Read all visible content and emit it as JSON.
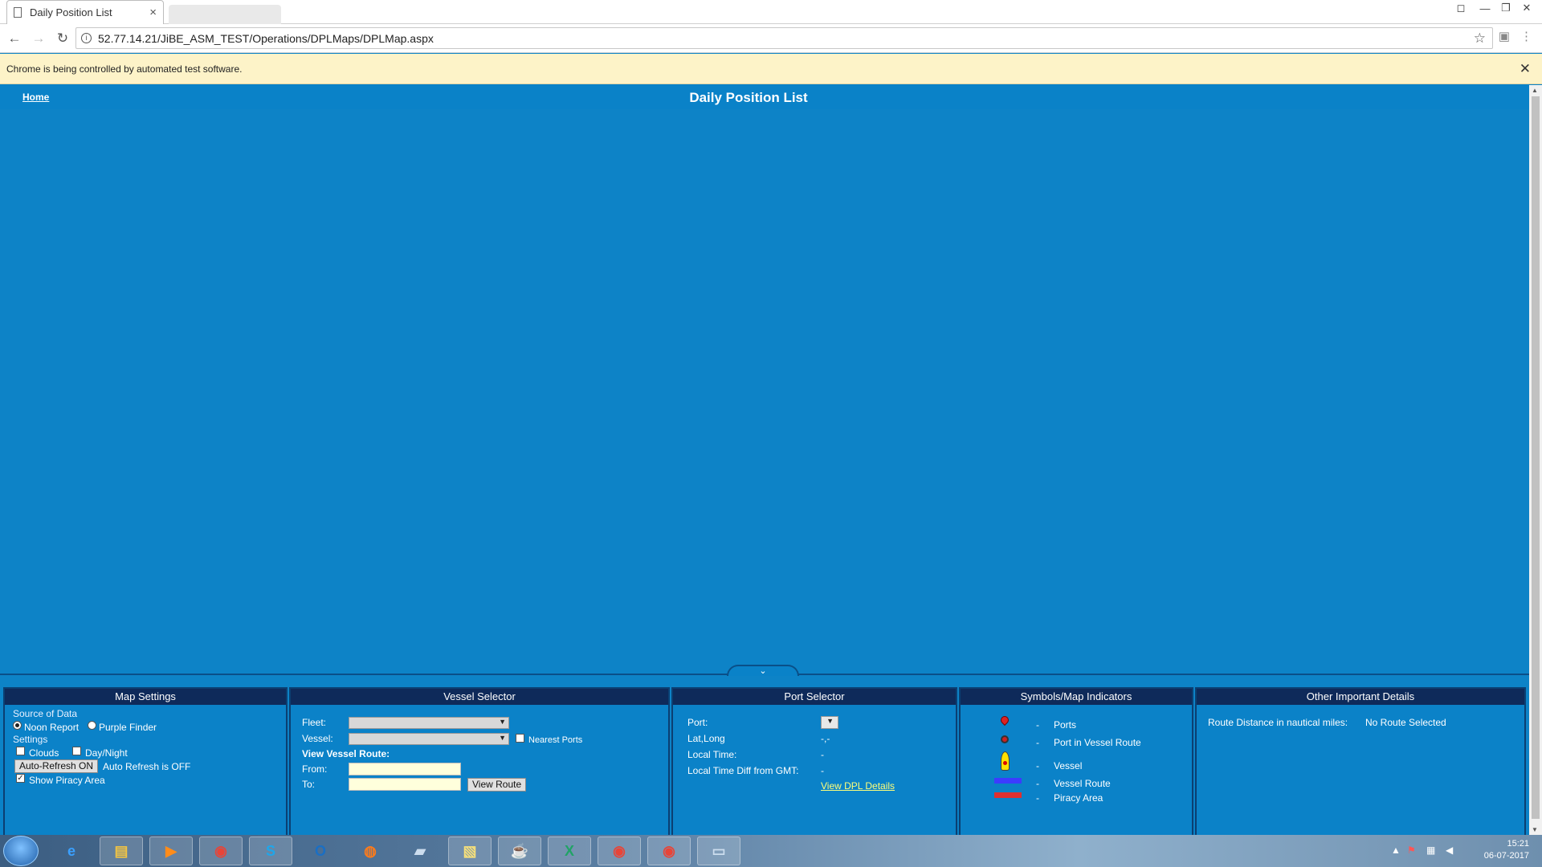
{
  "browser": {
    "tab_title": "Daily Position List",
    "tab_close": "×",
    "url": "52.77.14.21/JiBE_ASM_TEST/Operations/DPLMaps/DPLMap.aspx",
    "infobar_text": "Chrome is being controlled by automated test software.",
    "infobar_close": "✕"
  },
  "page": {
    "home_link": "Home",
    "title": "Daily Position List",
    "collapse_glyph": "⌄"
  },
  "map_settings": {
    "header": "Map Settings",
    "source_label": "Source of Data",
    "source_options": [
      "Noon Report",
      "Purple Finder"
    ],
    "settings_label": "Settings",
    "clouds_label": "Clouds",
    "daynight_label": "Day/Night",
    "auto_refresh_button": "Auto-Refresh ON",
    "auto_refresh_status": "Auto Refresh is OFF",
    "show_piracy_label": "Show Piracy Area"
  },
  "vessel_selector": {
    "header": "Vessel Selector",
    "fleet_label": "Fleet:",
    "vessel_label": "Vessel:",
    "nearest_ports_label": "Nearest Ports",
    "view_route_heading": "View Vessel Route:",
    "from_label": "From:",
    "to_label": "To:",
    "view_route_button": "View Route"
  },
  "port_selector": {
    "header": "Port Selector",
    "port_label": "Port:",
    "latlong_label": "Lat,Long",
    "latlong_value": "-,-",
    "local_time_label": "Local Time:",
    "local_time_value": "-",
    "time_diff_label": "Local Time Diff from GMT:",
    "time_diff_value": "-",
    "dpl_link": "View DPL Details"
  },
  "symbols": {
    "header": "Symbols/Map Indicators",
    "items": [
      {
        "dash": "-",
        "label": "Ports",
        "icon": "port-pin-icon"
      },
      {
        "dash": "-",
        "label": "Port in Vessel Route",
        "icon": "port-route-icon"
      },
      {
        "dash": "-",
        "label": "Vessel",
        "icon": "vessel-icon"
      },
      {
        "dash": "-",
        "label": "Vessel Route",
        "icon": "vessel-route-line",
        "color": "#3c3cff"
      },
      {
        "dash": "-",
        "label": "Piracy Area",
        "icon": "piracy-area-line",
        "color": "#e03030"
      }
    ]
  },
  "other_details": {
    "header": "Other Important Details",
    "route_distance_label": "Route Distance in nautical miles:",
    "route_distance_value": "No Route Selected"
  },
  "taskbar": {
    "time": "15:21",
    "date": "06-07-2017"
  },
  "colors": {
    "page_bg": "#0a82c8",
    "panel_header": "#0e2a5a",
    "link_yellow": "#ffff7a"
  }
}
